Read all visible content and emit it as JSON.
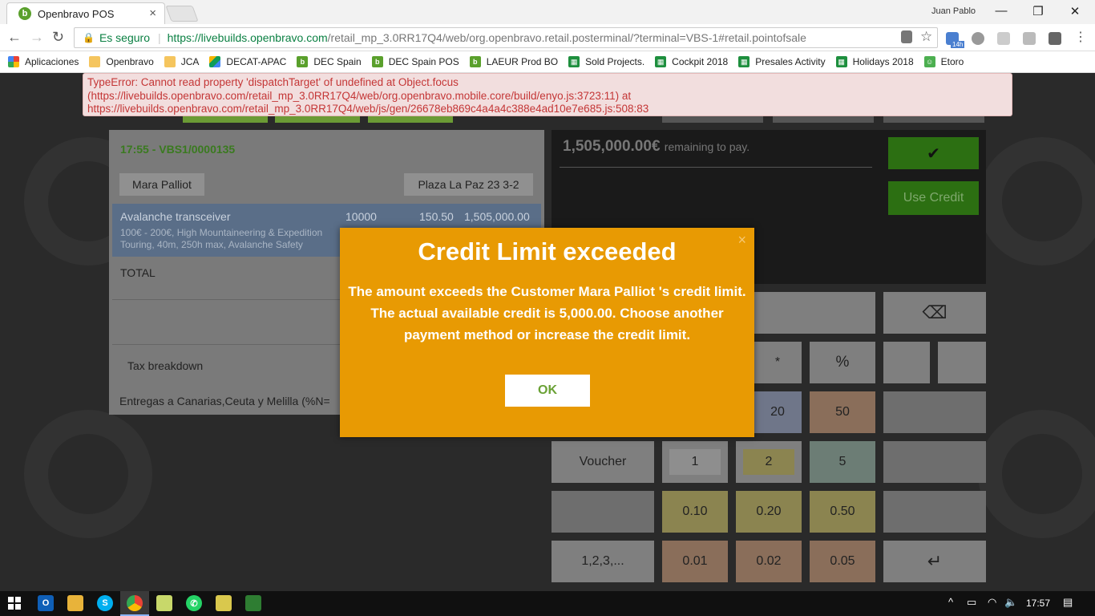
{
  "browser": {
    "tab_title": "Openbravo POS",
    "tab_close": "×",
    "user": "Juan Pablo",
    "window_controls": [
      "—",
      "❐",
      "✕"
    ],
    "secure_label": "Es seguro",
    "url_host": "https://livebuilds.openbravo.com",
    "url_rest": "/retail_mp_3.0RR17Q4/web/org.openbravo.retail.posterminal/?terminal=VBS-1#retail.pointofsale",
    "ext_badge": "14h",
    "bookmarks": [
      {
        "label": "Aplicaciones",
        "icon": "apps-grid-icon"
      },
      {
        "label": "Openbravo",
        "icon": "folder-icon"
      },
      {
        "label": "JCA",
        "icon": "folder-icon"
      },
      {
        "label": "DECAT-APAC",
        "icon": "drive-icon"
      },
      {
        "label": "DEC Spain",
        "icon": "openbravo-icon"
      },
      {
        "label": "DEC Spain POS",
        "icon": "openbravo-icon"
      },
      {
        "label": "LAEUR Prod BO",
        "icon": "openbravo-icon"
      },
      {
        "label": "Sold Projects.",
        "icon": "sheet-icon"
      },
      {
        "label": "Cockpit 2018",
        "icon": "sheet-icon"
      },
      {
        "label": "Presales Activity",
        "icon": "sheet-icon"
      },
      {
        "label": "Holidays 2018",
        "icon": "sheet-icon"
      },
      {
        "label": "Etoro",
        "icon": "etoro-icon"
      }
    ]
  },
  "error": {
    "line1": "TypeError: Cannot read property 'dispatchTarget' of undefined at Object.focus",
    "line2": "(https://livebuilds.openbravo.com/retail_mp_3.0RR17Q4/web/org.openbravo.mobile.core/build/enyo.js:3723:11) at",
    "line3": "https://livebuilds.openbravo.com/retail_mp_3.0RR17Q4/web/js/gen/26678eb869c4a4a4c388e4ad10e7e685.js:508:83"
  },
  "ticket": {
    "id": "17:55 - VBS1/0000135",
    "customer": "Mara Palliot",
    "address": "Plaza La Paz 23 3-2",
    "line": {
      "product": "Avalanche transceiver",
      "qty": "10000",
      "price": "150.50",
      "gross": "1,505,000.00",
      "desc1": "100€ - 200€, High Mountaineering & Expedition",
      "desc2": "Touring, 40m, 250h max, Avalanche Safety"
    },
    "total_label": "TOTAL",
    "tax_label": "Tax breakdown",
    "tax_line": "Entregas a Canarias,Ceuta y Melilla (%N="
  },
  "payment": {
    "amount": "1,505,000.00€",
    "remaining_label": "remaining to pay.",
    "ok_symbol": "✔",
    "use_credit": "Use Credit",
    "backspace_symbol": "⌫",
    "keys": {
      "multiply": "*",
      "percent": "%",
      "k20": "20",
      "k50": "50",
      "voucher": "Voucher",
      "k1": "1",
      "k2": "2",
      "k5": "5",
      "k010": "0.10",
      "k020": "0.20",
      "k050": "0.50",
      "seq": "1,2,3,...",
      "k001": "0.01",
      "k002": "0.02",
      "k005": "0.05",
      "enter": "↵"
    }
  },
  "modal": {
    "title": "Credit Limit exceeded",
    "close": "×",
    "line1": "The amount exceeds the Customer Mara Palliot 's credit limit.",
    "line2": "The actual available credit is 5,000.00. Choose another",
    "line3": "payment method or increase the credit limit.",
    "ok_label": "OK"
  },
  "taskbar": {
    "time": "17:57"
  }
}
